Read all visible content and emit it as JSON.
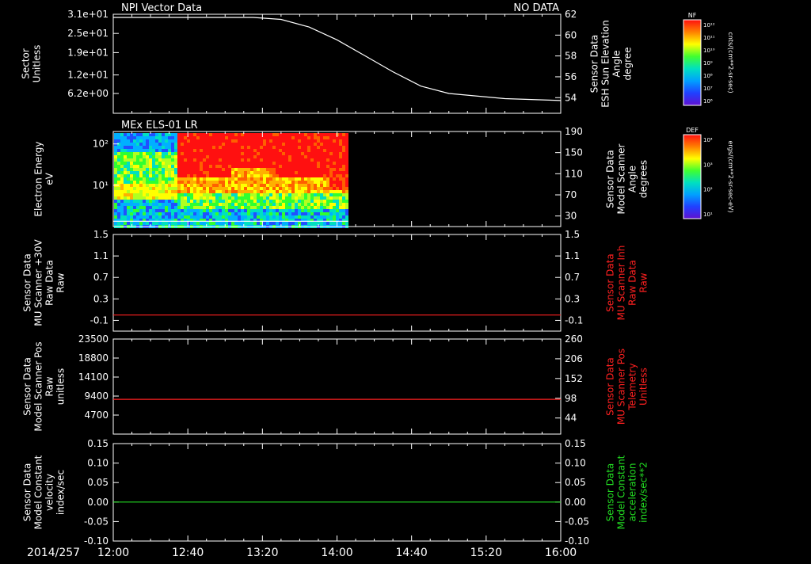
{
  "date_label": "2014/257",
  "time_ticks": [
    "12:00",
    "12:40",
    "13:20",
    "14:00",
    "14:40",
    "15:20",
    "16:00"
  ],
  "colors": {
    "white": "#ffffff",
    "red": "#ff2020",
    "green": "#22dd22",
    "background": "#000000"
  },
  "chart_data": [
    {
      "type": "line",
      "title": "NPI Vector Data",
      "status": "NO DATA",
      "ylabel": [
        "Sector",
        "Unitless"
      ],
      "yticks": [
        "3.1e+01",
        "2.5e+01",
        "1.9e+01",
        "1.2e+01",
        "6.2e+00"
      ],
      "ylim": [
        0,
        31
      ],
      "right_ylabel": [
        "Sensor Data",
        "ESH Sun Elevation",
        "Angle",
        "degree"
      ],
      "right_ylim": [
        52.5,
        62
      ],
      "right_yticks": [
        "62",
        "60",
        "58",
        "56",
        "54"
      ],
      "series": [
        {
          "color": "white",
          "axis": "left",
          "x": [
            0,
            0.75,
            1.0,
            1.25,
            1.5,
            1.75,
            2.0,
            2.25,
            2.5,
            2.75,
            3.0,
            3.5,
            4.0,
            5.0,
            10.0,
            20.0,
            30.0,
            40.0
          ],
          "y": [
            30,
            30,
            30,
            30,
            29.4,
            27,
            23,
            18,
            13,
            8.5,
            6.2,
            4.6,
            4.0,
            4.0,
            4.0,
            4.0,
            4.0,
            4.0
          ]
        }
      ]
    },
    {
      "type": "heatmap",
      "title": "MEx ELS-01 LR",
      "ylabel": [
        "Electron Energy",
        "eV"
      ],
      "yscale": "log",
      "ylim": [
        1,
        200
      ],
      "yticks": [
        "10²",
        "10¹"
      ],
      "yticks_values": [
        100,
        10
      ],
      "right_ylabel": [
        "Sensor Data",
        "Model Scanner",
        "Angle",
        "degrees"
      ],
      "right_ylim": [
        10,
        190
      ],
      "right_yticks": [
        "190",
        "150",
        "110",
        "70",
        "30"
      ],
      "colorbar_label": "DEF",
      "colorbar_unit": "ergs/(cm**2-sr-sec-eV)",
      "colorbar_ticks": [
        "10⁴",
        "10³",
        "10²",
        "10¹"
      ],
      "data_extent_hours": [
        0,
        2.1
      ],
      "high_band_start_hours": 0.55,
      "series": [
        {
          "color": "white",
          "axis": "right",
          "x": [
            0,
            2.1
          ],
          "y": [
            20,
            20
          ]
        }
      ]
    },
    {
      "type": "line",
      "ylabel": [
        "Sensor Data",
        "MU Scanner +30V",
        "Raw Data",
        "Raw"
      ],
      "ylim": [
        -0.3,
        1.5
      ],
      "yticks": [
        "1.5",
        "1.1",
        "0.7",
        "0.3",
        "-0.1"
      ],
      "right_ylabel": [
        "Sensor Data",
        "MU Scanner Inh",
        "Raw Data",
        "Raw"
      ],
      "right_ylim": [
        -0.3,
        1.5
      ],
      "right_yticks": [
        "1.5",
        "1.1",
        "0.7",
        "0.3",
        "-0.1"
      ],
      "series": [
        {
          "color": "red",
          "axis": "left",
          "x": [
            0,
            4
          ],
          "y": [
            0,
            0
          ]
        }
      ]
    },
    {
      "type": "line",
      "ylabel": [
        "Sensor Data",
        "Model Scanner Pos",
        "Raw",
        "unitless"
      ],
      "ylim": [
        0,
        23500
      ],
      "yticks": [
        "23500",
        "18800",
        "14100",
        "9400",
        "4700"
      ],
      "right_ylabel": [
        "Sensor Data",
        "MU Scanner Pos",
        "Telemetry",
        "Unitless"
      ],
      "right_ylim": [
        0,
        260
      ],
      "right_yticks": [
        "260",
        "206",
        "152",
        "98",
        "44"
      ],
      "series": [
        {
          "color": "red",
          "axis": "left",
          "x": [
            0,
            4
          ],
          "y": [
            8600,
            8600
          ]
        }
      ]
    },
    {
      "type": "line",
      "ylabel": [
        "Sensor Data",
        "Model Constant",
        "velocity",
        "index/sec"
      ],
      "ylim": [
        -0.1,
        0.15
      ],
      "yticks": [
        "0.15",
        "0.10",
        "0.05",
        "0.00",
        "-0.05",
        "-0.10"
      ],
      "right_ylabel": [
        "Sensor Data",
        "Model Constant",
        "acceleration",
        "index/sec**2"
      ],
      "right_ylim": [
        -0.1,
        0.15
      ],
      "right_yticks": [
        "0.15",
        "0.10",
        "0.05",
        "0.00",
        "-0.05",
        "-0.10"
      ],
      "series": [
        {
          "color": "green",
          "axis": "left",
          "x": [
            0,
            4
          ],
          "y": [
            0,
            0
          ]
        }
      ]
    }
  ],
  "colorbar_top": {
    "label": "NF",
    "unit": "cnts/(cm**2-sr-sec)",
    "ticks": [
      "10¹²",
      "10¹¹",
      "10¹⁰",
      "10⁹",
      "10⁸",
      "10⁷",
      "10⁶"
    ]
  }
}
